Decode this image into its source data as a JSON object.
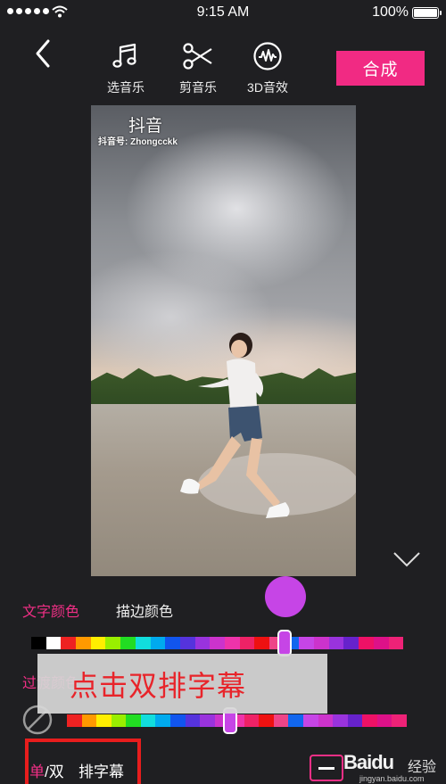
{
  "status_bar": {
    "time": "9:15 AM",
    "battery": "100%",
    "battery_level": 1.0
  },
  "toolbar": {
    "back_icon": "chevron-left-icon",
    "tools": [
      {
        "label": "选音乐",
        "icon": "music-note-icon"
      },
      {
        "label": "剪音乐",
        "icon": "scissors-icon"
      },
      {
        "label": "3D音效",
        "icon": "waveform-icon"
      }
    ],
    "compose_label": "合成"
  },
  "video": {
    "app_logo": "抖音",
    "account_id": "抖音号: Zhongcckk"
  },
  "editor": {
    "collapse_icon": "chevron-down-icon",
    "tabs": [
      {
        "label": "文字颜色",
        "active": true
      },
      {
        "label": "描边颜色",
        "active": false
      }
    ],
    "preview_color": "#c645e6",
    "fade_color_label": "过渡颜色",
    "palette": [
      "#000000",
      "#ffffff",
      "#ee2222",
      "#ff9900",
      "#ffee00",
      "#99ee00",
      "#22dd22",
      "#11dddd",
      "#00aaee",
      "#1155ee",
      "#5533dd",
      "#9933dd",
      "#cc33cc",
      "#ee33aa",
      "#ee2266",
      "#ee1111",
      "#ee4488",
      "#1166ee",
      "#c645e6",
      "#cc33cc",
      "#9933dd",
      "#6622cc",
      "#ee1166",
      "#dd1188",
      "#ee2277"
    ],
    "selected_text_color_position": 0.68,
    "selected_fade_color_position": 0.48,
    "hint_text": "点击双排字幕"
  },
  "bottom_bar": {
    "single_label": "单",
    "separator": "/",
    "double_label": "双",
    "subtitle_label": "排字幕"
  },
  "watermark": {
    "brand": "Baidu",
    "product": "经验",
    "site": "jingyan.baidu.com"
  },
  "colors": {
    "accent": "#f22f86",
    "background": "#1f1f22",
    "highlight_box": "#e81d1d"
  }
}
